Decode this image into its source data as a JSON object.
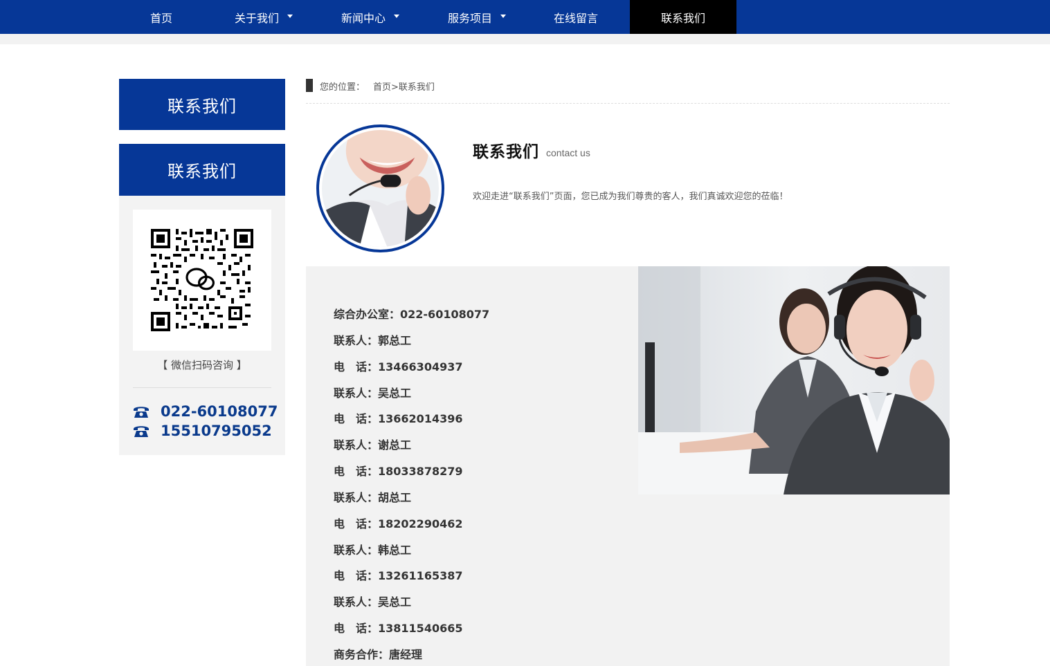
{
  "nav": {
    "items": [
      {
        "label": "首页",
        "has_dropdown": false
      },
      {
        "label": "关于我们",
        "has_dropdown": true
      },
      {
        "label": "新闻中心",
        "has_dropdown": true
      },
      {
        "label": "服务项目",
        "has_dropdown": true
      },
      {
        "label": "在线留言",
        "has_dropdown": false
      },
      {
        "label": "联系我们",
        "has_dropdown": false,
        "active": true
      }
    ]
  },
  "sidebar": {
    "heading": "联系我们",
    "subheading": "联系我们",
    "qr_caption": "【 微信扫码咨询 】",
    "phones": [
      "022-60108077",
      "15510795052"
    ],
    "phone_icon": "telephone-icon"
  },
  "breadcrumb": {
    "label": "您的位置：",
    "path": "首页>联系我们"
  },
  "contact": {
    "title": "联系我们",
    "subtitle": "contact us",
    "welcome": "欢迎走进“联系我们”页面，您已成为我们尊贵的客人，我们真诚欢迎您的莅临！"
  },
  "info": {
    "lines": [
      {
        "label": "综合办公室：",
        "value": "022-60108077"
      },
      {
        "label": "联系人：",
        "value": "郭总工"
      },
      {
        "label": "电　话：",
        "value": "13466304937"
      },
      {
        "label": "联系人：",
        "value": "吴总工"
      },
      {
        "label": "电　话：",
        "value": "13662014396"
      },
      {
        "label": "联系人：",
        "value": "谢总工"
      },
      {
        "label": "电　话：",
        "value": "18033878279"
      },
      {
        "label": "联系人：",
        "value": "胡总工"
      },
      {
        "label": "电　话：",
        "value": "18202290462"
      },
      {
        "label": "联系人：",
        "value": "韩总工"
      },
      {
        "label": "电　话：",
        "value": "13261165387"
      },
      {
        "label": "联系人：",
        "value": "吴总工"
      },
      {
        "label": "电　话：",
        "value": "13811540665"
      },
      {
        "label": "商务合作：",
        "value": "唐经理"
      }
    ]
  },
  "colors": {
    "brand_blue": "#063797",
    "active_nav": "#000000",
    "panel_gray": "#f2f2f2",
    "phone_text": "#0a3a8c"
  }
}
